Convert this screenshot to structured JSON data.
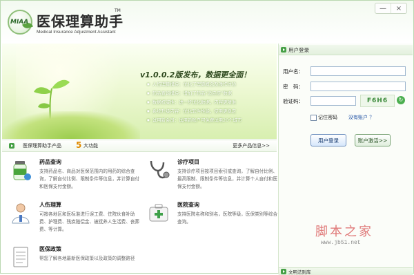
{
  "app": {
    "title": "医保理算助手",
    "tm": "TM",
    "subtitle": "Medical Insurance Adjustment Assistant",
    "logo_text": "MIAA"
  },
  "window_controls": {
    "minimize": "—",
    "close": "×"
  },
  "banner": {
    "headline": "v1.0.0.2版发布，数据更全面！",
    "items": [
      "人伤理算模块：优化了理算概念及操作体验",
      "药品查询模块：增加了药品“适应症”数据",
      "数据权威性：进一步优化数据，内容更精准",
      "系统升级内容：优化软件性能，使用更稳定",
      "试用新会员：试用新账户可免费试用20个城市"
    ]
  },
  "strip": {
    "prefix": "医保理算助手产品",
    "count": "5",
    "suffix": "大功能",
    "more": "更多产品信息>>"
  },
  "features": [
    {
      "title": "药品查询",
      "desc": "支持药品名、商品对医保范围内的用药的综合查询，了解自付比例、限制条件等信息，并计算自付和医保支付金额。"
    },
    {
      "title": "诊疗项目",
      "desc": "支持诊疗项目按项目索引或查询，了解自付比例、最高限制、限制条件等信息，并计算个人自付和医保支付金额。"
    },
    {
      "title": "人伤理算",
      "desc": "可按各地区和医标准进行误工费、住院伙食补助费、护理费、残疾赔偿金、被抚养人生活费、丧葬费、等计算。"
    },
    {
      "title": "医院查询",
      "desc": "支持医院名称和别名，医院等级，医保类别等综合查询。"
    },
    {
      "title": "医保政策",
      "desc": "帮您了解各地最新医保政策以及政策的调整路径"
    }
  ],
  "login": {
    "section_title": "用户登录",
    "username_label": "用户名：",
    "password_label": "密　码：",
    "captcha_label": "验证码：",
    "captcha_code": "F6H6",
    "remember_label": "记住密码",
    "no_account": "没有账户 ？",
    "login_button": "用户登录",
    "activate_button": "账户激活>>",
    "footer_section": "文明法则库"
  },
  "watermark": {
    "cn": "脚本之家",
    "url": "www.jb51.net"
  }
}
